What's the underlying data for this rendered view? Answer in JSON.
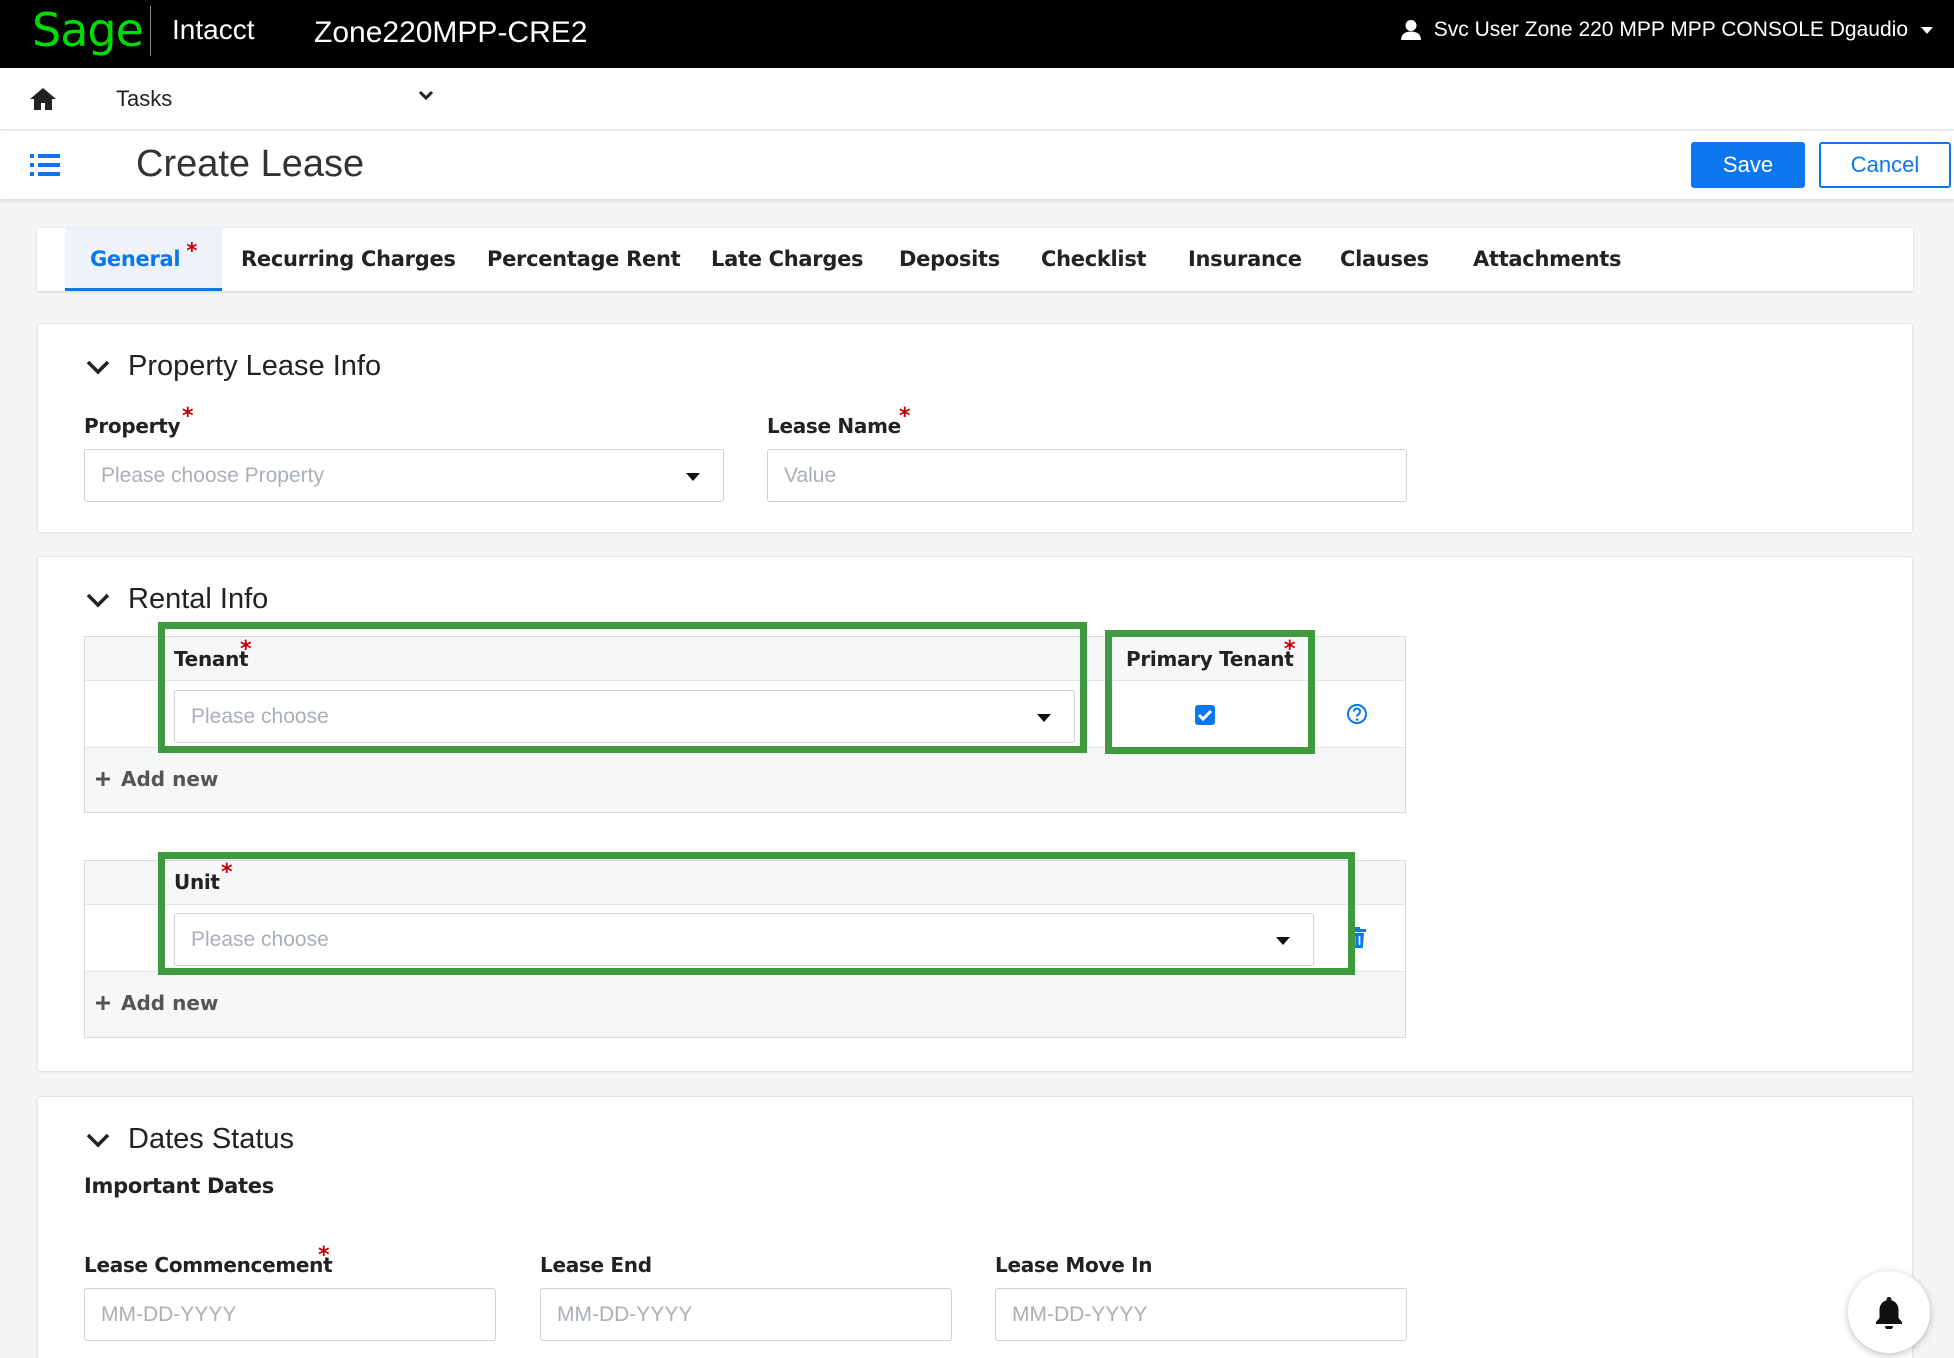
{
  "topbar": {
    "logo": "Sage",
    "app_name": "Intacct",
    "company": "Zone220MPP-CRE2",
    "user": "Svc User Zone 220 MPP MPP CONSOLE Dgaudio"
  },
  "nav": {
    "tasks_label": "Tasks"
  },
  "page": {
    "title": "Create Lease",
    "save_label": "Save",
    "cancel_label": "Cancel"
  },
  "tabs": [
    {
      "label": "General",
      "required": "*",
      "active": true
    },
    {
      "label": "Recurring Charges"
    },
    {
      "label": "Percentage Rent"
    },
    {
      "label": "Late Charges"
    },
    {
      "label": "Deposits"
    },
    {
      "label": "Checklist"
    },
    {
      "label": "Insurance"
    },
    {
      "label": "Clauses"
    },
    {
      "label": "Attachments"
    }
  ],
  "required_mark": "*",
  "property_lease_info": {
    "title": "Property Lease Info",
    "property_label": "Property",
    "property_placeholder": "Please choose Property",
    "lease_name_label": "Lease Name",
    "lease_name_placeholder": "Value"
  },
  "rental_info": {
    "title": "Rental Info",
    "tenant_label": "Tenant",
    "tenant_placeholder": "Please choose",
    "primary_tenant_label": "Primary Tenant",
    "primary_tenant_checked": true,
    "unit_label": "Unit",
    "unit_placeholder": "Please choose",
    "add_new_label": "Add new"
  },
  "dates_status": {
    "title": "Dates Status",
    "subtitle": "Important Dates",
    "lease_commencement_label": "Lease Commencement",
    "lease_end_label": "Lease End",
    "lease_move_in_label": "Lease Move In",
    "date_placeholder": "MM-DD-YYYY"
  },
  "colors": {
    "brand_green": "#00dc00",
    "accent_blue": "#0b76ee",
    "required_red": "#c40000",
    "highlight_green": "#3f9a3f"
  }
}
